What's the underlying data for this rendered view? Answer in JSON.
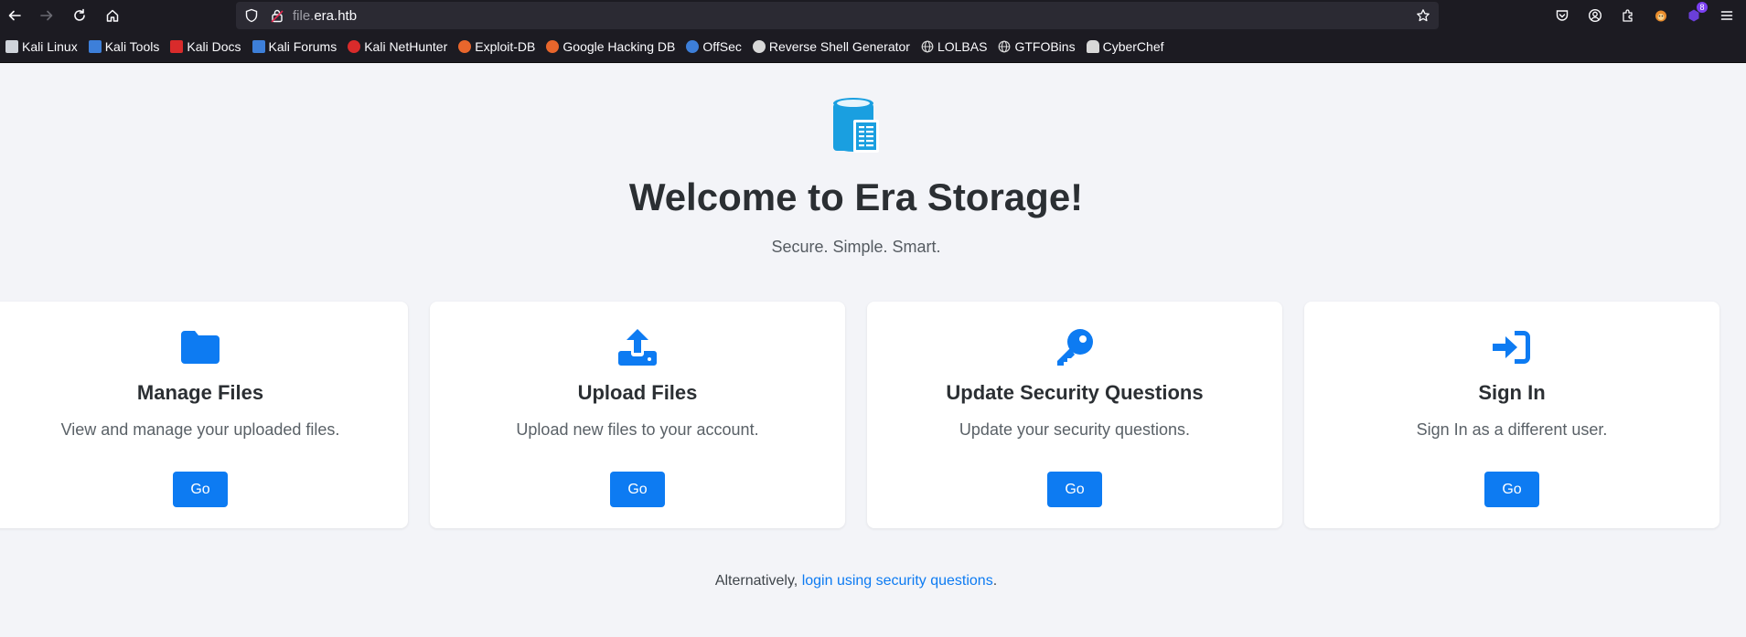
{
  "browser": {
    "url_prefix": "file.",
    "url_domain": "era.htb",
    "extension_badge": "8",
    "bookmarks": [
      {
        "label": "Kali Linux",
        "icon": "kali-dragon-icon",
        "color": "#cfd3da"
      },
      {
        "label": "Kali Tools",
        "icon": "kali-tools-icon",
        "color": "#3d7fd9"
      },
      {
        "label": "Kali Docs",
        "icon": "kali-docs-icon",
        "color": "#d92b2b"
      },
      {
        "label": "Kali Forums",
        "icon": "kali-forums-icon",
        "color": "#3d7fd9"
      },
      {
        "label": "Kali NetHunter",
        "icon": "kali-nethunter-icon",
        "color": "#d92b2b"
      },
      {
        "label": "Exploit-DB",
        "icon": "exploit-db-icon",
        "color": "#e8662c"
      },
      {
        "label": "Google Hacking DB",
        "icon": "ghdb-icon",
        "color": "#e8662c"
      },
      {
        "label": "OffSec",
        "icon": "offsec-icon",
        "color": "#3d7fd9"
      },
      {
        "label": "Reverse Shell Generator",
        "icon": "skull-icon",
        "color": "#d8d8d8"
      },
      {
        "label": "LOLBAS",
        "icon": "globe-icon",
        "color": "#d8d8d8"
      },
      {
        "label": "GTFOBins",
        "icon": "globe-icon",
        "color": "#d8d8d8"
      },
      {
        "label": "CyberChef",
        "icon": "chef-hat-icon",
        "color": "#d8d8d8"
      }
    ]
  },
  "hero": {
    "title": "Welcome to Era Storage!",
    "subtitle": "Secure. Simple. Smart."
  },
  "cards": [
    {
      "title": "Manage Files",
      "description": "View and manage your uploaded files.",
      "button": "Go",
      "icon": "folder-icon"
    },
    {
      "title": "Upload Files",
      "description": "Upload new files to your account.",
      "button": "Go",
      "icon": "upload-icon"
    },
    {
      "title": "Update Security Questions",
      "description": "Update your security questions.",
      "button": "Go",
      "icon": "key-icon"
    },
    {
      "title": "Sign In",
      "description": "Sign In as a different user.",
      "button": "Go",
      "icon": "sign-in-icon"
    }
  ],
  "footer": {
    "prefix": "Alternatively, ",
    "link": "login using security questions",
    "suffix": "."
  },
  "colors": {
    "accent": "#0d7bf2",
    "logo": "#1a9fe0",
    "background": "#f3f4f8"
  }
}
